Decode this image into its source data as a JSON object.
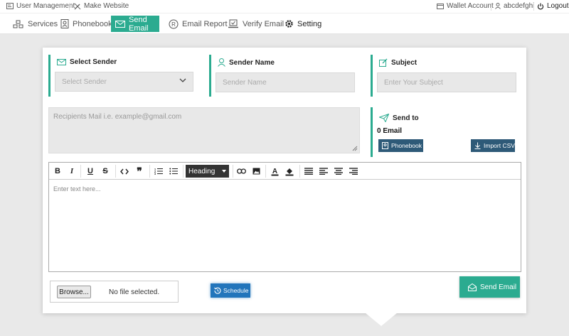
{
  "topbar": {
    "user_management": "User Management",
    "make_website": "Make Website",
    "wallet_account": "Wallet Account",
    "username": "abcdefghi",
    "logout": "Logout"
  },
  "nav": {
    "services": "Services",
    "phonebook": "Phonebook",
    "send_email": "Send Email",
    "email_report": "Email Report",
    "verify_email": "Verify Email",
    "setting": "Setting"
  },
  "select_sender": {
    "title": "Select Sender",
    "selected": "Select Sender"
  },
  "sender_name": {
    "title": "Sender Name",
    "placeholder": "Sender Name"
  },
  "subject": {
    "title": "Subject",
    "placeholder": "Enter Your Subject"
  },
  "recipients": {
    "placeholder": "Recipients Mail i.e. example@gmail.com"
  },
  "send_to": {
    "title": "Send to",
    "count": "0 Email",
    "phonebook_btn": "Phonebook",
    "import_btn": "Import CSV"
  },
  "editor": {
    "heading_label": "Heading",
    "placeholder": "Enter text here..."
  },
  "file": {
    "browse": "Browse...",
    "status": "No file selected."
  },
  "schedule_btn": "Schedule",
  "send_btn": "Send Email",
  "colors": {
    "accent": "#2bab90",
    "dark_button": "#2e5a78",
    "schedule": "#2275bb"
  }
}
